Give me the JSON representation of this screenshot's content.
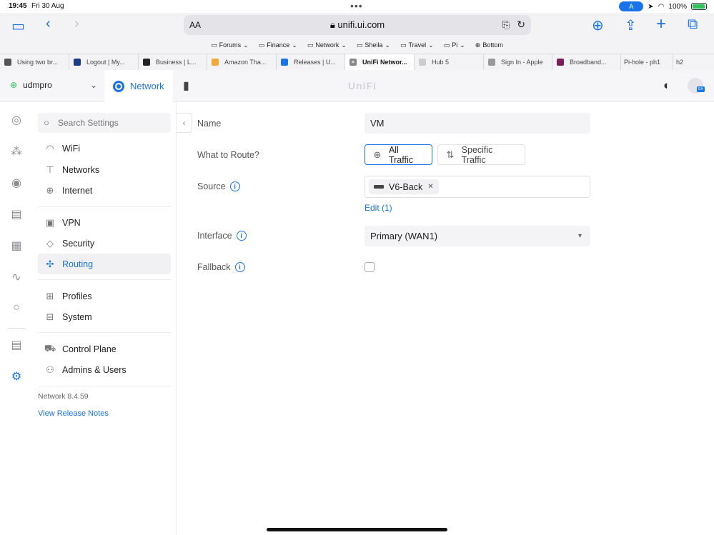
{
  "status": {
    "time": "19:45",
    "date": "Fri 30 Aug",
    "battery": "100%",
    "assistant_badge": "A"
  },
  "browser": {
    "text_size": "AA",
    "url": "unifi.ui.com",
    "favorites": [
      "Forums",
      "Finance",
      "Network",
      "Sheila",
      "Travel",
      "Pi",
      "Bottom"
    ],
    "tabs": [
      {
        "label": "Using two br...",
        "color": "#555"
      },
      {
        "label": "Logout | My...",
        "color": "#1a3a8a"
      },
      {
        "label": "Business | L...",
        "color": "#222"
      },
      {
        "label": "Amazon Tha...",
        "color": "#f2a93b"
      },
      {
        "label": "Releases | U...",
        "color": "#1a73e8"
      },
      {
        "label": "UniFi Networ...",
        "color": "#888",
        "active": true
      },
      {
        "label": "Hub 5",
        "color": "#ccc"
      },
      {
        "label": "Sign In - Apple",
        "color": "#999"
      },
      {
        "label": "Broadband...",
        "color": "#7a1e5a"
      },
      {
        "label": "Pi-hole - ph1",
        "color": ""
      },
      {
        "label": "h2",
        "color": ""
      }
    ]
  },
  "header": {
    "site": "udmpro",
    "app": "Network",
    "logo": "UniFi",
    "avatar_initials": "EA"
  },
  "rail": [
    "dashboard-icon",
    "topology-icon",
    "clients-icon",
    "devices-icon",
    "ports-icon",
    "insights-icon",
    "alerts-icon",
    "logs-icon",
    "settings-icon"
  ],
  "nav": {
    "search_placeholder": "Search Settings",
    "groups": [
      [
        "WiFi",
        "Networks",
        "Internet"
      ],
      [
        "VPN",
        "Security",
        "Routing"
      ],
      [
        "Profiles",
        "System"
      ],
      [
        "Control Plane",
        "Admins & Users"
      ]
    ],
    "active": "Routing",
    "version": "Network 8.4.59",
    "release_notes": "View Release Notes"
  },
  "form": {
    "name_label": "Name",
    "name_value": "VM",
    "route_label": "What to Route?",
    "route_options": [
      "All Traffic",
      "Specific Traffic"
    ],
    "route_selected": "All Traffic",
    "source_label": "Source",
    "source_chip": "V6-Back",
    "source_edit": "Edit (1)",
    "interface_label": "Interface",
    "interface_value": "Primary (WAN1)",
    "fallback_label": "Fallback",
    "fallback_checked": false
  }
}
